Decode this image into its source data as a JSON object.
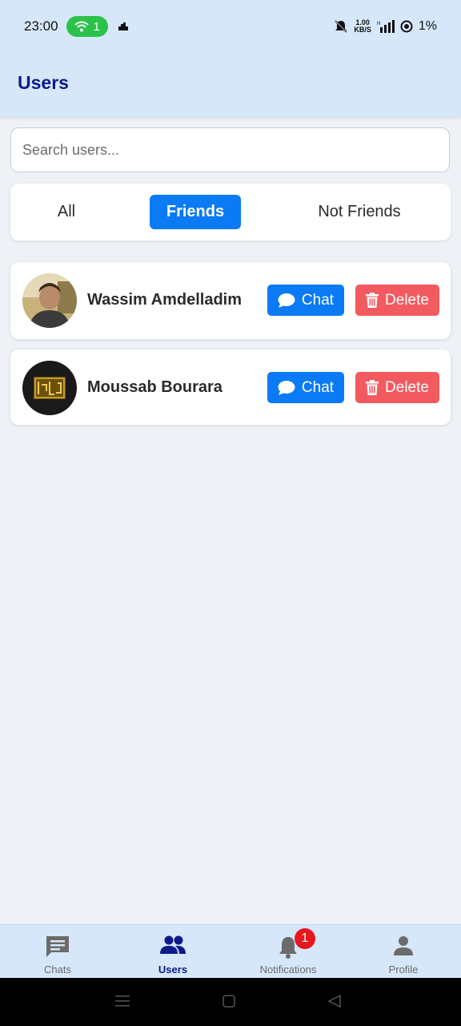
{
  "status_bar": {
    "time": "23:00",
    "hotspot_count": "1",
    "speed_value": "1.00",
    "speed_unit": "KB/S",
    "battery": "1%"
  },
  "header": {
    "title": "Users"
  },
  "search": {
    "placeholder": "Search users..."
  },
  "filters": [
    {
      "label": "All",
      "active": false
    },
    {
      "label": "Friends",
      "active": true
    },
    {
      "label": "Not Friends",
      "active": false
    }
  ],
  "users": [
    {
      "name": "Wassim Amdelladim",
      "chat_label": "Chat",
      "delete_label": "Delete"
    },
    {
      "name": "Moussab Bourara",
      "chat_label": "Chat",
      "delete_label": "Delete"
    }
  ],
  "bottom_nav": {
    "items": [
      {
        "label": "Chats",
        "icon": "chat-bubble-icon",
        "active": false
      },
      {
        "label": "Users",
        "icon": "users-icon",
        "active": true
      },
      {
        "label": "Notifications",
        "icon": "bell-icon",
        "active": false,
        "badge": "1"
      },
      {
        "label": "Profile",
        "icon": "person-icon",
        "active": false
      }
    ]
  },
  "colors": {
    "header_bg": "#d6e7fa",
    "primary": "#0a7af5",
    "danger": "#f25a5f",
    "title": "#0d1a8a",
    "badge": "#e8161e"
  }
}
